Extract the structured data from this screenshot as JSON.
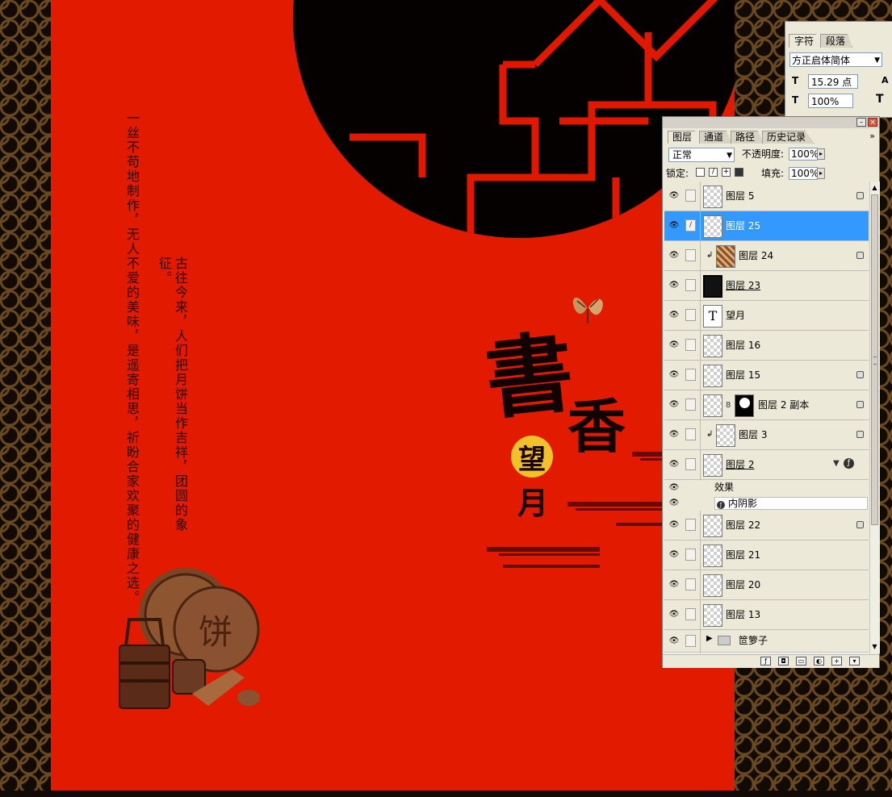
{
  "artwork": {
    "vertical_text_1": "一丝不苟地制作，无人不爱的美味，是遥寄相思，祈盼合家欢聚的健康之选。",
    "vertical_text_2": "古往今来，人们把月饼当作吉祥，团圆的象征。",
    "calligraphy_shu": "書",
    "calligraphy_xiang": "香",
    "wang": "望",
    "yue": "月",
    "basket_glyph": "饼"
  },
  "character_panel": {
    "tabs": [
      "字符",
      "段落"
    ],
    "font_family": "方正启体简体",
    "font_size": "15.29 点",
    "leading_value": "100%",
    "colors": {
      "bg": "#ece9d8"
    }
  },
  "layers_panel": {
    "tabs": [
      "图层",
      "通道",
      "路径",
      "历史记录"
    ],
    "blend_mode": "正常",
    "opacity_label": "不透明度:",
    "opacity_value": "100%",
    "lock_label": "锁定:",
    "fill_label": "填充:",
    "fill_value": "100%",
    "layers": [
      {
        "name": "图层 5",
        "locked": true
      },
      {
        "name": "图层 25",
        "selected": true
      },
      {
        "name": "图层 24",
        "locked": true
      },
      {
        "name": "图层 23"
      },
      {
        "name": "望月"
      },
      {
        "name": "图层 16"
      },
      {
        "name": "图层 15",
        "locked": true
      },
      {
        "name": "图层 2 副本",
        "locked": true
      },
      {
        "name": "图层 3",
        "locked": true
      },
      {
        "name": "图层 2"
      },
      {
        "name": "图层 22",
        "locked": true
      },
      {
        "name": "图层 21"
      },
      {
        "name": "图层 20"
      },
      {
        "name": "图层 13"
      },
      {
        "name": "笸箩子"
      }
    ],
    "effects_label": "效果",
    "effect_inner_shadow": "内阴影",
    "selection_color": "#3399ff"
  }
}
